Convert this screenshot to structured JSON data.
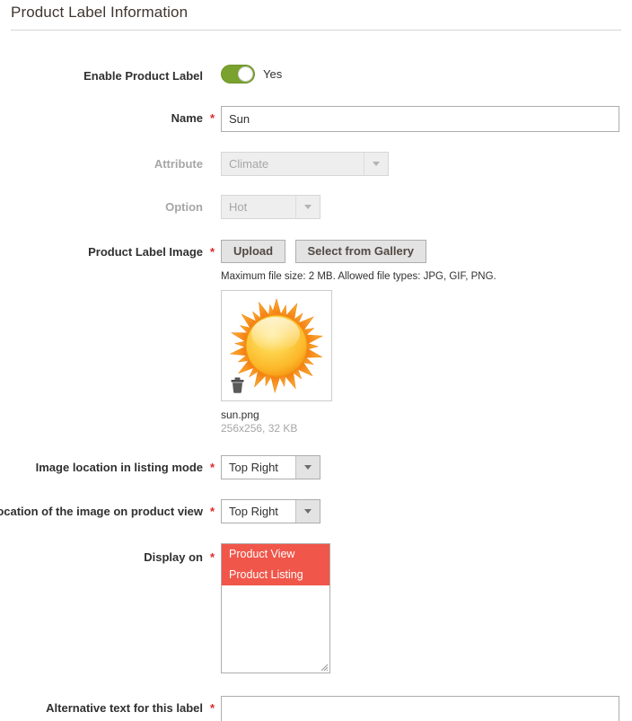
{
  "section": {
    "title": "Product Label Information"
  },
  "fields": {
    "enable": {
      "label": "Enable Product Label",
      "toggle_state": "on",
      "value_text": "Yes"
    },
    "name": {
      "label": "Name",
      "required_marker": "*",
      "value": "Sun",
      "placeholder": ""
    },
    "attribute": {
      "label": "Attribute",
      "value": "Climate",
      "disabled": true
    },
    "option": {
      "label": "Option",
      "value": "Hot",
      "disabled": true
    },
    "product_label_image": {
      "label": "Product Label Image",
      "required_marker": "*",
      "upload_button": "Upload",
      "gallery_button": "Select from Gallery",
      "hint": "Maximum file size: 2 MB. Allowed file types: JPG, GIF, PNG.",
      "preview": {
        "image_name": "sun-image",
        "file_name": "sun.png",
        "file_meta": "256x256, 32 KB",
        "delete_icon": "trash-icon"
      }
    },
    "listing_location": {
      "label": "Image location in listing mode",
      "required_marker": "*",
      "value": "Top Right"
    },
    "product_view_location": {
      "label": "Location of the image on product view",
      "required_marker": "*",
      "value": "Top Right"
    },
    "display_on": {
      "label": "Display on",
      "required_marker": "*",
      "options": [
        {
          "label": "Product View",
          "selected": true
        },
        {
          "label": "Product Listing",
          "selected": true
        }
      ]
    },
    "alt_text": {
      "label": "Alternative text for this label",
      "required_marker": "*",
      "value": "",
      "placeholder": ""
    }
  },
  "colors": {
    "toggle_on": "#79a22e",
    "required_asterisk": "#e22626",
    "multiselect_selection": "#f0564a",
    "sun_outer": "#f5901e",
    "sun_inner": "#fbbe3a",
    "title_text": "#41362f"
  }
}
